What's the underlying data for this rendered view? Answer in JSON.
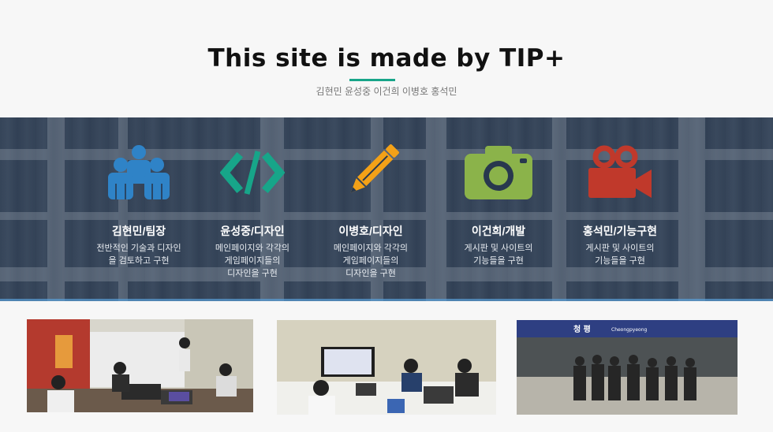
{
  "header": {
    "title": "This site is made by TIP+",
    "subtitle": "김현민 윤성중 이건희 이병호 홍석민"
  },
  "colors": {
    "accent": "#17a589",
    "overlay": "#28384e"
  },
  "members": [
    {
      "name": "김현민/팀장",
      "desc": "전반적인 기술과 디자인\n을 검토하고 구현",
      "icon": "team-icon",
      "icon_color": "#2f83c7"
    },
    {
      "name": "윤성중/디자인",
      "desc": "메인페이지와 각각의\n게임페이지들의\n디자인을 구현",
      "icon": "code-icon",
      "icon_color": "#17a589"
    },
    {
      "name": "이병호/디자인",
      "desc": "메인페이지와 각각의\n게임페이지들의\n디자인을 구현",
      "icon": "pencil-icon",
      "icon_color": "#f3a117"
    },
    {
      "name": "이건희/개발",
      "desc": "게시판 및 사이트의\n기능들을 구현",
      "icon": "camera-icon",
      "icon_color": "#8bb34a"
    },
    {
      "name": "홍석민/기능구현",
      "desc": "게시판 및 사이트의\n기능들을 구현",
      "icon": "video-camera-icon",
      "icon_color": "#c0392b"
    }
  ],
  "photos": [
    {
      "name": "team-photo-office"
    },
    {
      "name": "team-photo-workspace"
    },
    {
      "name": "team-photo-station",
      "sign_text": "청 평",
      "sign_sub": "Cheongpyeong"
    }
  ]
}
